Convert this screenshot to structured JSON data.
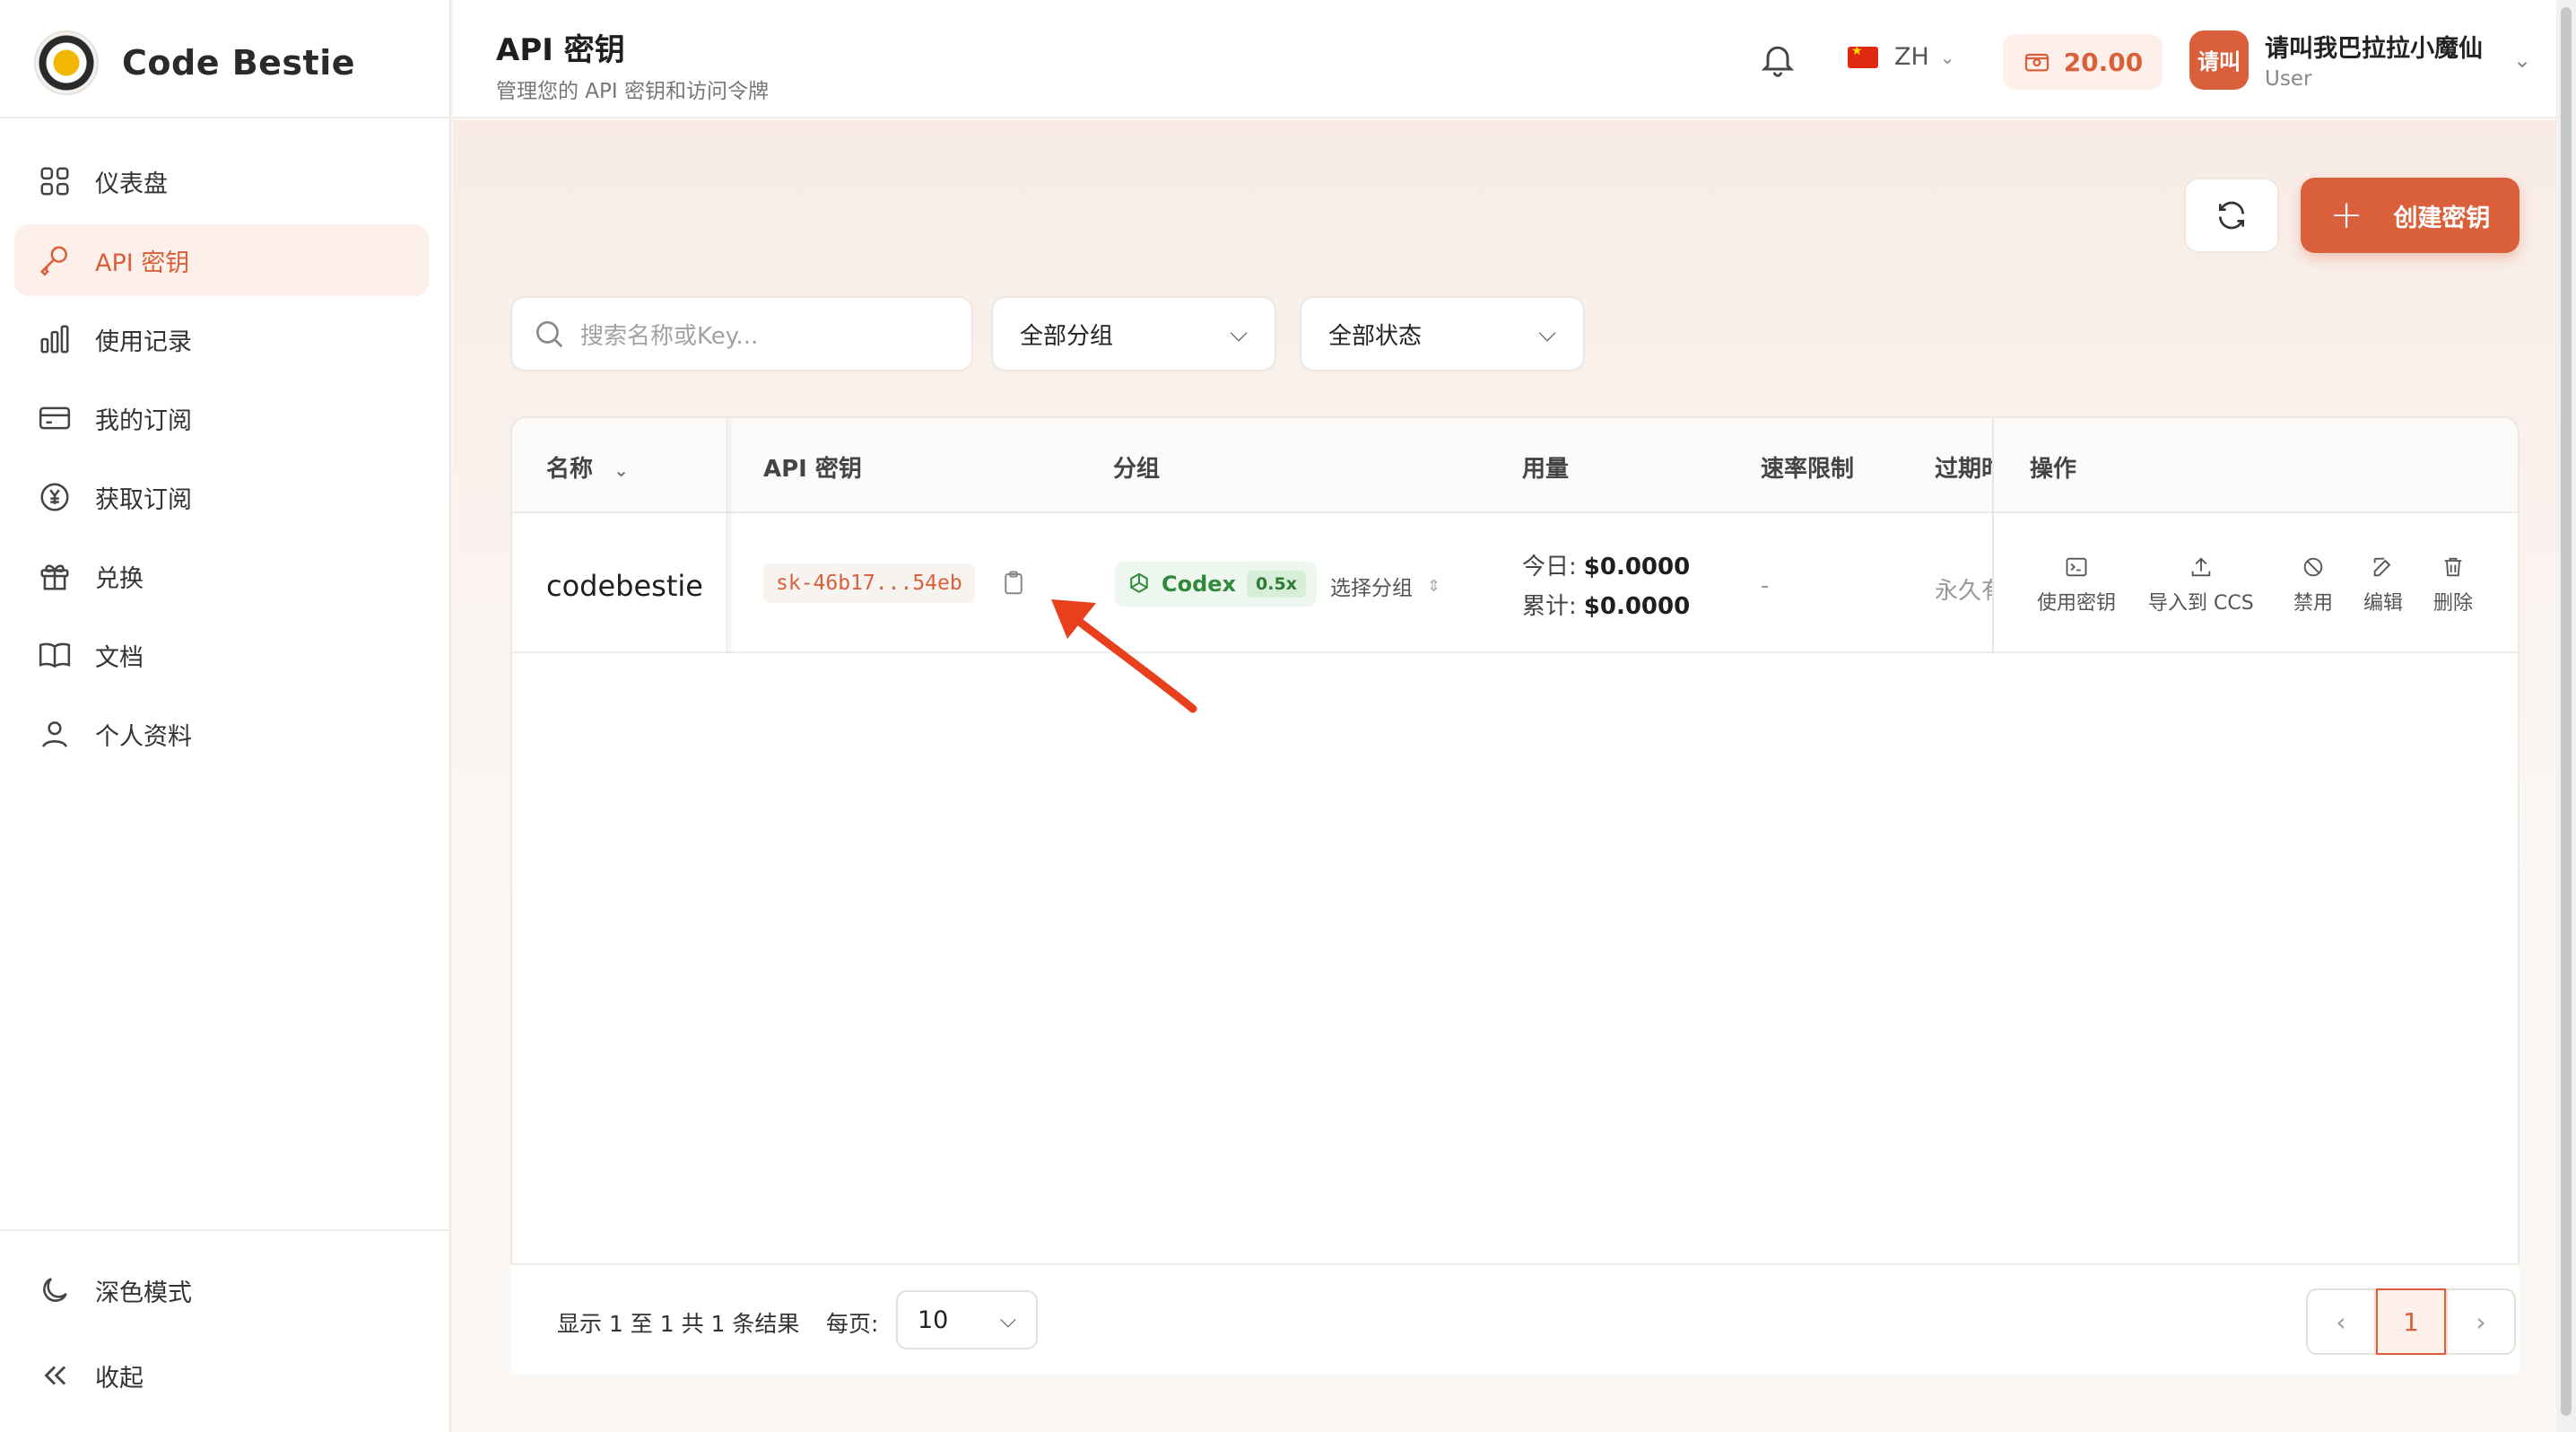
{
  "brand": {
    "name": "Code Bestie"
  },
  "sidebar": {
    "items": [
      {
        "label": "仪表盘",
        "icon": "dashboard-icon",
        "active": false
      },
      {
        "label": "API 密钥",
        "icon": "key-icon",
        "active": true
      },
      {
        "label": "使用记录",
        "icon": "bar-chart-icon",
        "active": false
      },
      {
        "label": "我的订阅",
        "icon": "card-icon",
        "active": false
      },
      {
        "label": "获取订阅",
        "icon": "yen-coin-icon",
        "active": false
      },
      {
        "label": "兑换",
        "icon": "gift-icon",
        "active": false
      },
      {
        "label": "文档",
        "icon": "book-icon",
        "active": false
      },
      {
        "label": "个人资料",
        "icon": "user-icon",
        "active": false
      }
    ],
    "dark_mode_label": "深色模式",
    "collapse_label": "收起"
  },
  "header": {
    "title": "API 密钥",
    "subtitle": "管理您的 API 密钥和访问令牌",
    "language": "ZH",
    "balance": "20.00",
    "user": {
      "avatar_text": "请叫",
      "name": "请叫我巴拉拉小魔仙",
      "role": "User"
    }
  },
  "toolbar": {
    "create_label": "创建密钥",
    "search_placeholder": "搜索名称或Key...",
    "group_filter": "全部分组",
    "status_filter": "全部状态"
  },
  "table": {
    "columns": [
      "名称",
      "API 密钥",
      "分组",
      "用量",
      "速率限制",
      "过期时间",
      "操作"
    ],
    "header_visible": {
      "name": "名称",
      "key": "API 密钥",
      "group": "分组",
      "usage": "用量",
      "rate": "速率限制",
      "expiry": "过期时",
      "actions": "操作"
    },
    "rows": [
      {
        "name": "codebestie",
        "key": "sk-46b17...54eb",
        "group": "Codex",
        "group_multiplier": "0.5x",
        "choose_group": "选择分组",
        "usage_today_label": "今日:",
        "usage_today": "$0.0000",
        "usage_total_label": "累计:",
        "usage_total": "$0.0000",
        "rate_limit": "-",
        "expiry": "永久有效",
        "actions": [
          "使用密钥",
          "导入到 CCS",
          "禁用",
          "编辑",
          "删除"
        ]
      }
    ]
  },
  "pagination": {
    "summary": "显示 1 至 1 共 1 条结果",
    "per_page_label": "每页:",
    "per_page": "10",
    "current_page": "1"
  },
  "colors": {
    "accent": "#d9603b",
    "accent_bg": "#fdf0ea",
    "group_green": "#2f8a3c",
    "annotation_arrow": "#e8401c"
  }
}
